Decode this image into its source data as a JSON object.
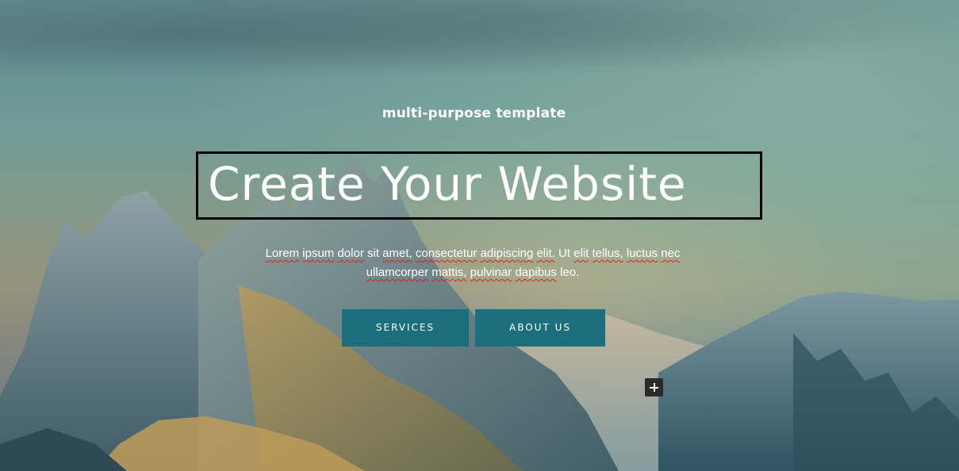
{
  "hero": {
    "eyebrow": "multi-purpose template",
    "title": "Create Your Website",
    "description_line1_words": [
      "Lorem",
      "ipsum",
      "dolor",
      "sit",
      "amet,",
      "consectetur",
      "adipiscing",
      "elit.",
      "Ut",
      "elit",
      "tellus,",
      "luctus",
      "nec"
    ],
    "description_line2_words": [
      "ullamcorper",
      "mattis,",
      "pulvinar",
      "dapibus",
      "leo."
    ],
    "buttons": {
      "services": "SERVICES",
      "about": "ABOUT US"
    },
    "add_icon": "plus-icon"
  },
  "colors": {
    "button_bg": "#1b6f7d",
    "selection_border": "#000000",
    "spellcheck_underline": "#e02020",
    "text": "#ffffff"
  }
}
